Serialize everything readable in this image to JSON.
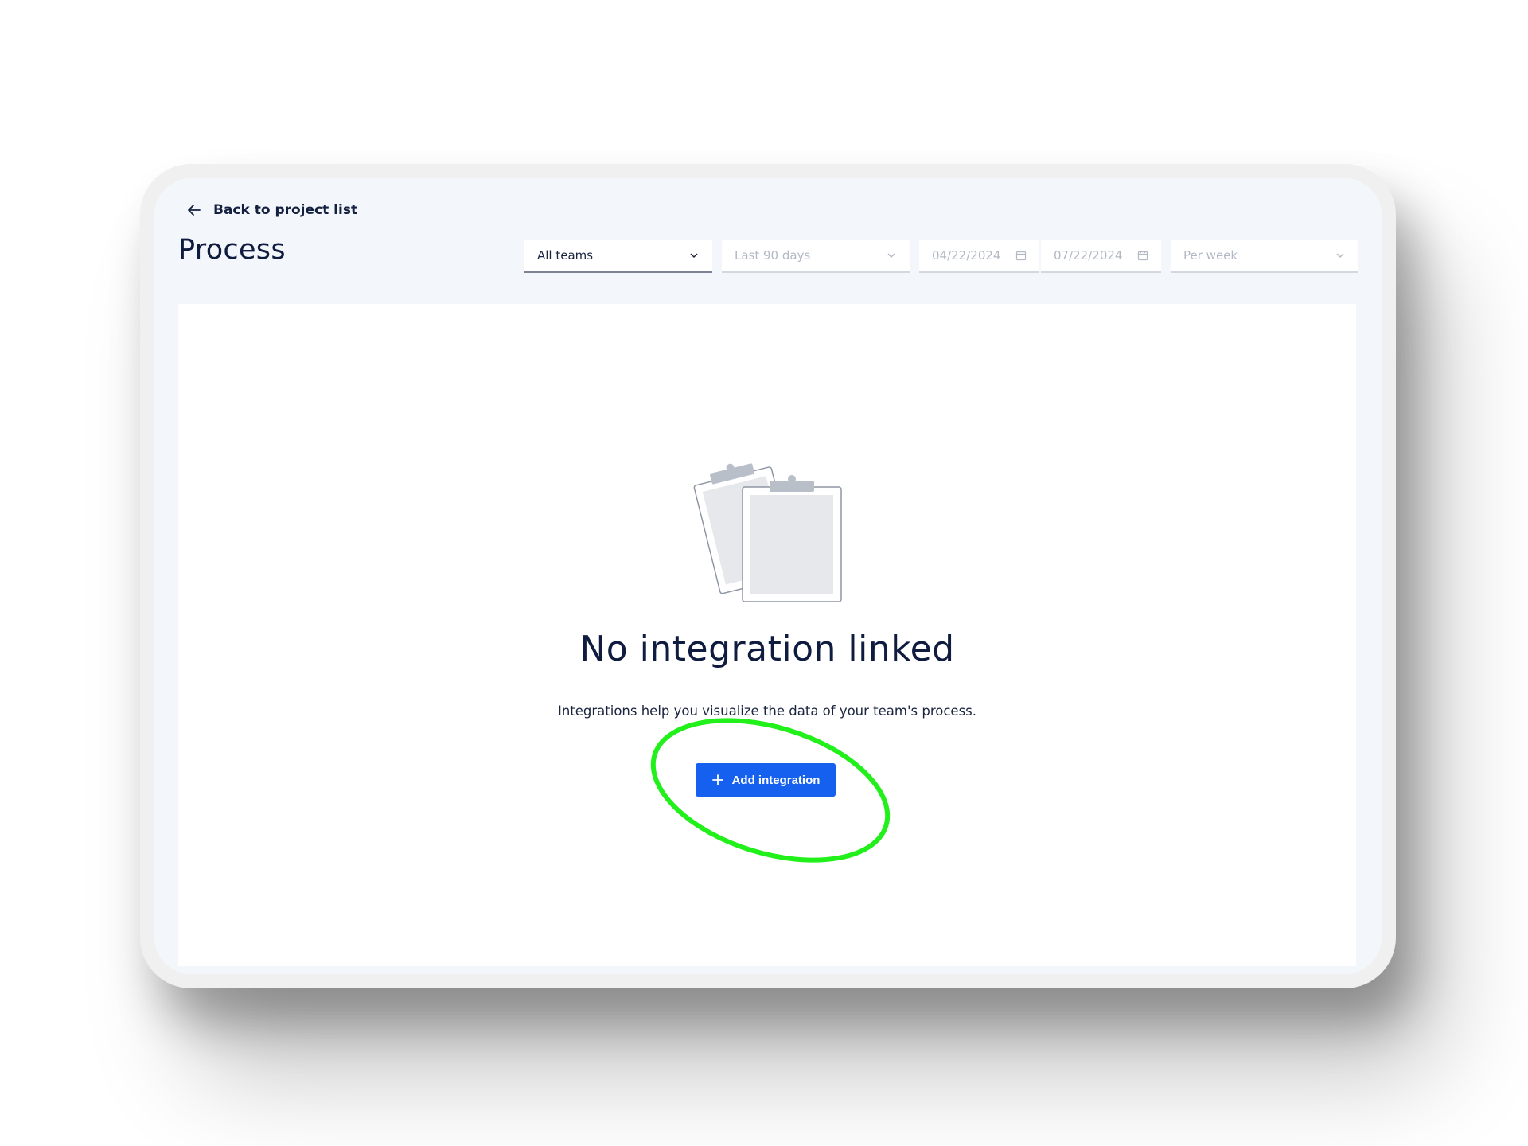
{
  "header": {
    "back_label": "Back to project list",
    "title": "Process"
  },
  "filters": {
    "team": {
      "value": "All teams",
      "state": "enabled"
    },
    "period": {
      "value": "Last 90 days",
      "state": "disabled"
    },
    "start_date": {
      "value": "04/22/2024",
      "state": "disabled"
    },
    "end_date": {
      "value": "07/22/2024",
      "state": "disabled"
    },
    "granularity": {
      "value": "Per week",
      "state": "disabled"
    }
  },
  "empty_state": {
    "title": "No integration linked",
    "description": "Integrations help you visualize the data of your team's process.",
    "button_label": "Add integration",
    "illustration": "clipboards-illustration"
  },
  "annotation": {
    "shape": "ellipse",
    "color": "#22f01a",
    "target": "add-integration-button"
  },
  "colors": {
    "primary": "#1660f0",
    "text": "#0f1c3f",
    "screen_background": "#f3f6fa"
  }
}
